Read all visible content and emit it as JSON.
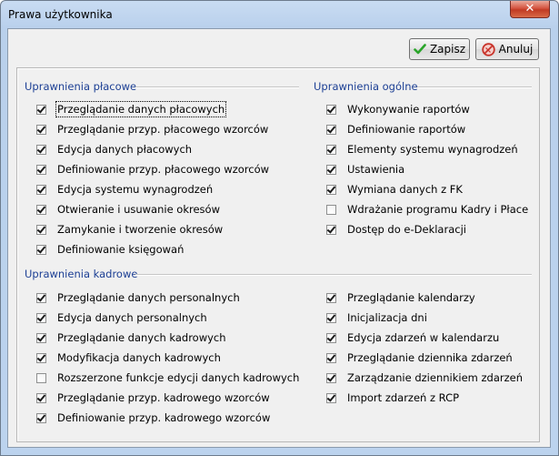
{
  "window": {
    "title": "Prawa użytkownika",
    "close_label": "✕"
  },
  "toolbar": {
    "save_label": "Zapisz",
    "cancel_label": "Anuluj"
  },
  "colors": {
    "section_title": "#1c3f94",
    "save_icon": "#2aa52a",
    "cancel_icon": "#c8332a"
  },
  "sections": {
    "placowe": {
      "title": "Uprawnienia płacowe",
      "items": [
        {
          "label": "Przeglądanie danych płacowych",
          "checked": true
        },
        {
          "label": "Przeglądanie przyp. płacowego wzorców",
          "checked": true
        },
        {
          "label": "Edycja danych płacowych",
          "checked": true
        },
        {
          "label": "Definiowanie przyp. płacowego wzorców",
          "checked": true
        },
        {
          "label": "Edycja systemu wynagrodzeń",
          "checked": true
        },
        {
          "label": "Otwieranie i usuwanie okresów",
          "checked": true
        },
        {
          "label": "Zamykanie i tworzenie okresów",
          "checked": true
        },
        {
          "label": "Definiowanie księgowań",
          "checked": true
        }
      ]
    },
    "ogolne": {
      "title": "Uprawnienia ogólne",
      "items": [
        {
          "label": "Wykonywanie raportów",
          "checked": true
        },
        {
          "label": "Definiowanie raportów",
          "checked": true
        },
        {
          "label": "Elementy systemu wynagrodzeń",
          "checked": true
        },
        {
          "label": "Ustawienia",
          "checked": true
        },
        {
          "label": "Wymiana danych z FK",
          "checked": true
        },
        {
          "label": "Wdrażanie programu Kadry i Płace",
          "checked": false
        },
        {
          "label": "Dostęp do e-Deklaracji",
          "checked": true
        }
      ]
    },
    "kadrowe": {
      "title": "Uprawnienia kadrowe",
      "left_items": [
        {
          "label": "Przeglądanie danych personalnych",
          "checked": true
        },
        {
          "label": "Edycja danych personalnych",
          "checked": true
        },
        {
          "label": "Przeglądanie danych kadrowych",
          "checked": true
        },
        {
          "label": "Modyfikacja danych kadrowych",
          "checked": true
        },
        {
          "label": "Rozszerzone funkcje edycji danych kadrowych",
          "checked": false
        },
        {
          "label": "Przeglądanie przyp. kadrowego wzorców",
          "checked": true
        },
        {
          "label": "Definiowanie przyp. kadrowego wzorców",
          "checked": true
        }
      ],
      "right_items": [
        {
          "label": "Przeglądanie kalendarzy",
          "checked": true
        },
        {
          "label": "Inicjalizacja dni",
          "checked": true
        },
        {
          "label": "Edycja zdarzeń w kalendarzu",
          "checked": true
        },
        {
          "label": "Przeglądanie dziennika zdarzeń",
          "checked": true
        },
        {
          "label": "Zarządzanie dziennikiem zdarzeń",
          "checked": true
        },
        {
          "label": "Import zdarzeń z RCP",
          "checked": true
        }
      ]
    }
  }
}
